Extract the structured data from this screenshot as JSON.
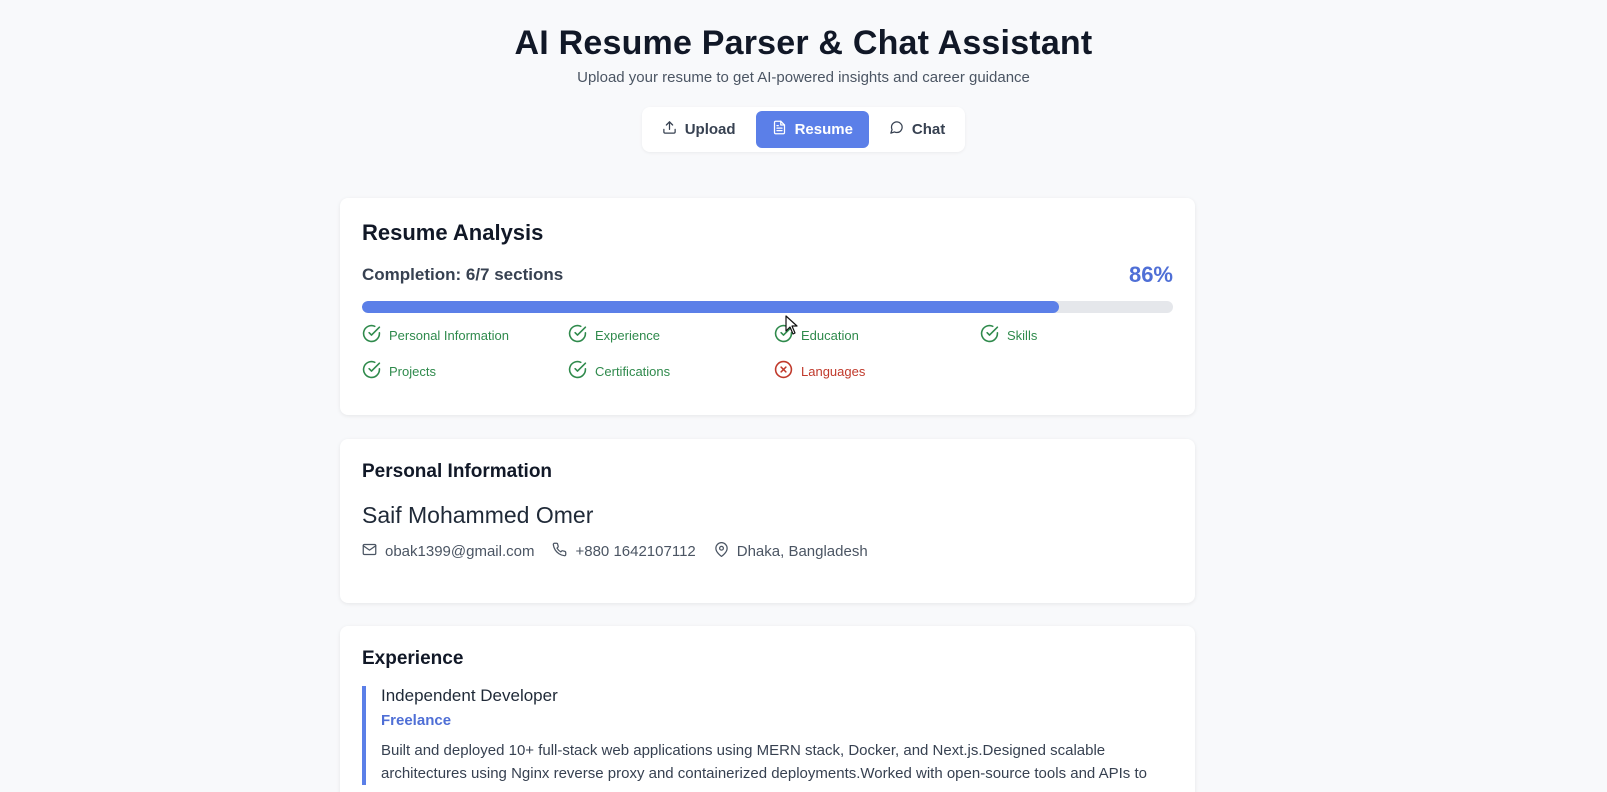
{
  "header": {
    "title": "AI Resume Parser & Chat Assistant",
    "subtitle": "Upload your resume to get AI-powered insights and career guidance"
  },
  "tabs": [
    {
      "label": "Upload",
      "icon": "upload-icon",
      "active": false
    },
    {
      "label": "Resume",
      "icon": "document-icon",
      "active": true
    },
    {
      "label": "Chat",
      "icon": "chat-icon",
      "active": false
    }
  ],
  "analysis": {
    "title": "Resume Analysis",
    "completion_label": "Completion: 6/7 sections",
    "completion_percent": "86%",
    "progress_fraction": 0.86,
    "sections": [
      {
        "label": "Personal Information",
        "complete": true
      },
      {
        "label": "Experience",
        "complete": true
      },
      {
        "label": "Education",
        "complete": true
      },
      {
        "label": "Skills",
        "complete": true
      },
      {
        "label": "Projects",
        "complete": true
      },
      {
        "label": "Certifications",
        "complete": true
      },
      {
        "label": "Languages",
        "complete": false
      }
    ]
  },
  "personal": {
    "title": "Personal Information",
    "name": "Saif Mohammed Omer",
    "email": "obak1399@gmail.com",
    "phone": "+880 1642107112",
    "location": "Dhaka, Bangladesh"
  },
  "experience": {
    "title": "Experience",
    "entries": [
      {
        "role": "Independent Developer",
        "company": "Freelance",
        "description": "Built and deployed 10+ full-stack web applications using MERN stack, Docker, and Next.js.Designed scalable architectures using Nginx reverse proxy and containerized deployments.Worked with open-source tools and APIs to"
      }
    ]
  },
  "colors": {
    "accent": "#5b7fe8",
    "accent_text": "#4f6fd6",
    "success": "#2f8a4c",
    "error": "#c0392b",
    "track": "#e5e7eb"
  }
}
